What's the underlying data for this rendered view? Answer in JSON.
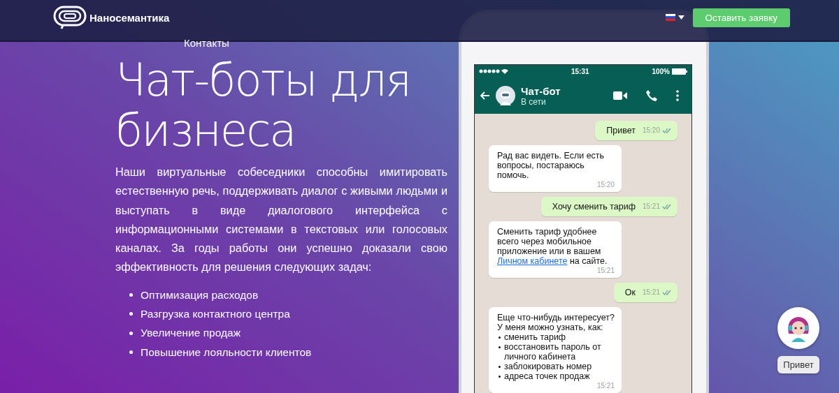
{
  "header": {
    "logo": "Наносемантика",
    "cta": "Оставить заявку"
  },
  "nav": {
    "contacts": "Контакты"
  },
  "hero": {
    "title": "Чат-боты для бизнеса",
    "description": "Наши виртуальные собеседники способны имитировать естественную речь, поддерживать диалог с живыми людьми и выступать в виде диалогового интерфейса с информационными системами в текстовых или голосовых каналах. За годы работы они успешно доказали свою эффективность для решения следующих задач:",
    "bullets": [
      "Оптимизация расходов",
      "Разгрузка контактного центра",
      "Увеличение продаж",
      "Повышение лояльности клиентов"
    ]
  },
  "phone": {
    "status_bar": {
      "time": "15:31",
      "battery": "100%"
    },
    "chat": {
      "name": "Чат-бот",
      "status": "В сети"
    },
    "messages": [
      {
        "kind": "outgoing",
        "text": "Привет",
        "time": "15:20",
        "read": true
      },
      {
        "kind": "incoming",
        "text": "Рад вас видеть. Если есть вопросы, постараюсь помочь.",
        "time": "15:20"
      },
      {
        "kind": "outgoing",
        "text": "Хочу сменить тариф",
        "time": "15:21",
        "read": true
      },
      {
        "kind": "incoming",
        "text": "Сменить тариф удобнее всего через мобильное приложение или в вашем",
        "link": "Личном кабинете",
        "after": "на сайте.",
        "time": "15:21"
      },
      {
        "kind": "outgoing",
        "text": "Ок",
        "time": "15:21",
        "read": true
      },
      {
        "kind": "incoming",
        "text": "Еще что-нибудь интересует? У меня можно узнать, как:",
        "items": [
          "сменить тариф",
          "восстановить пароль от личного кабинета",
          "заблокировать номер",
          "адреса точек продаж"
        ],
        "time": "15:21"
      }
    ]
  },
  "assistant_widget": {
    "greeting": "Привет"
  }
}
